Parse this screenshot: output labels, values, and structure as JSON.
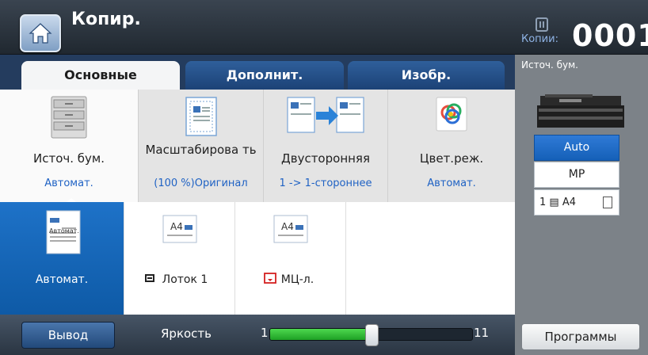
{
  "header": {
    "title": "Копир.",
    "counter_label": "Копии:",
    "counter_value": "0001"
  },
  "tabs": [
    {
      "label": "Основные",
      "active": true
    },
    {
      "label": "Дополнит.",
      "active": false
    },
    {
      "label": "Изобр.",
      "active": false
    }
  ],
  "options": [
    {
      "label": "Источ. бум.",
      "value": "Автомат.",
      "icon": "paper-tray-icon"
    },
    {
      "label": "Масштабирова ть",
      "value": "(100 %)Оригинал",
      "icon": "scale-document-icon"
    },
    {
      "label": "Двусторонняя",
      "value": "1 -> 1-стороннее",
      "icon": "duplex-icon"
    },
    {
      "label": "Цвет.реж.",
      "value": "Автомат.",
      "icon": "color-wheel-icon"
    }
  ],
  "paper_sources": [
    {
      "label": "Автомат.",
      "doc_text": "Автомат.",
      "selected": true
    },
    {
      "label": "Лоток 1",
      "doc_text": "A4",
      "prefix_icon": "tray-icon"
    },
    {
      "label": "МЦ-л.",
      "doc_text": "A4",
      "prefix_icon": "bypass-tray-icon"
    }
  ],
  "bottom": {
    "output_label": "Вывод",
    "brightness_label": "Яркость",
    "brightness_min": "1",
    "brightness_max": "11",
    "brightness_value": 6
  },
  "right_panel": {
    "label": "Источ. бум.",
    "trays": [
      "Auto",
      "MP",
      "1 ▤ A4"
    ],
    "programs_label": "Программы"
  },
  "colors": {
    "accent": "#1f62c4",
    "tab_active": "#f4f5f6",
    "selected_source": "#0e5aa6",
    "slider_fill": "#1ea124"
  }
}
